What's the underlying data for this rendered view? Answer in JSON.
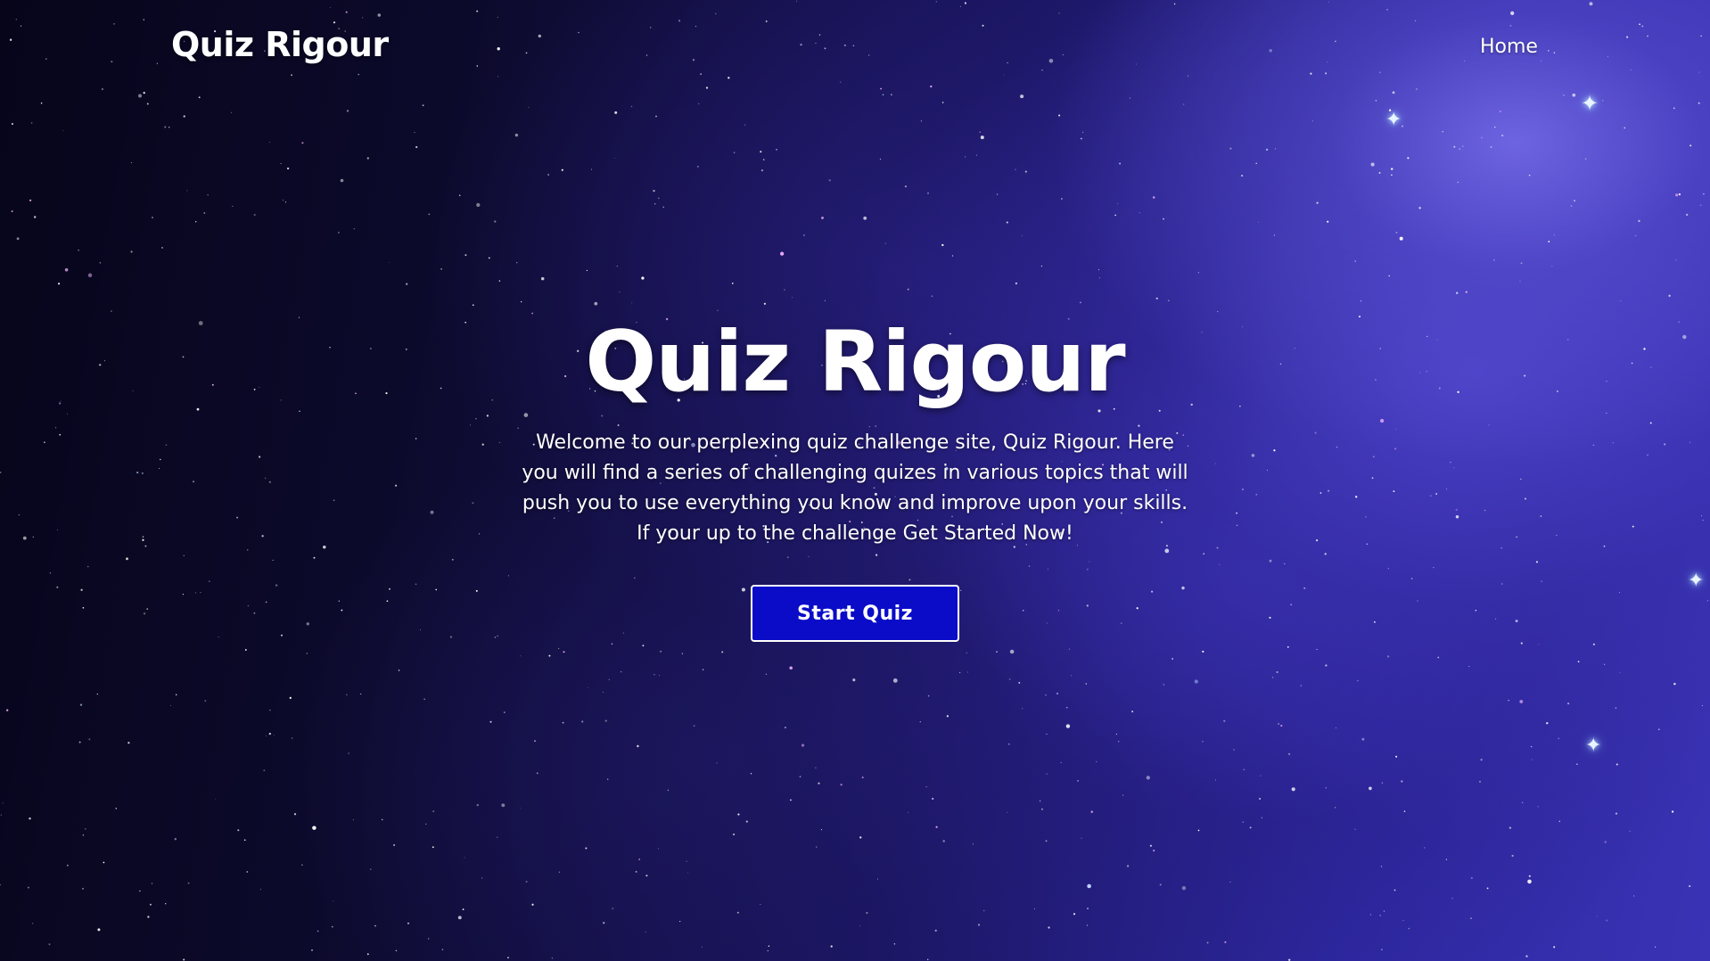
{
  "nav": {
    "logo": "Quiz Rigour",
    "home_label": "Home"
  },
  "hero": {
    "title": "Quiz Rigour",
    "description": "Welcome to our perplexing quiz challenge site, Quiz Rigour. Here you will find a series of challenging quizes in various topics that will push you to use everything you know and improve upon your skills. If your up to the challenge Get Started Now!",
    "button_label": "Start Quiz"
  },
  "colors": {
    "button_bg": "#0a0cc8",
    "text": "#ffffff",
    "background_dark": "#07051a",
    "background_nebula": "#3a33b5"
  }
}
